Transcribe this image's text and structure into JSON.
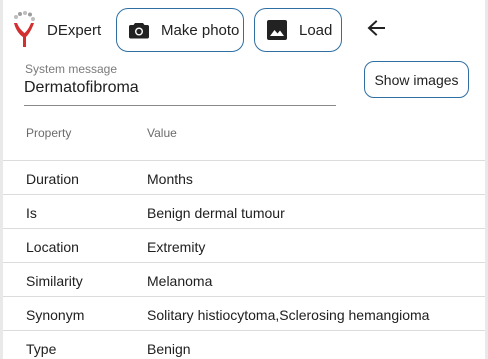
{
  "app": {
    "title": "DExpert"
  },
  "toolbar": {
    "photo_label": "Make photo",
    "load_label": "Load"
  },
  "system_message": {
    "label": "System message",
    "value": "Dermatofibroma"
  },
  "show_images_label": "Show images",
  "table": {
    "headers": [
      "Property",
      "Value"
    ],
    "rows": [
      [
        "Duration",
        "Months"
      ],
      [
        "Is",
        "Benign dermal tumour"
      ],
      [
        "Location",
        "Extremity"
      ],
      [
        "Similarity",
        "Melanoma"
      ],
      [
        "Synonym",
        "Solitary histiocytoma,Sclerosing hemangioma"
      ],
      [
        "Type",
        "Benign"
      ]
    ]
  },
  "colors": {
    "accent": "#2f6fa3",
    "logo_red": "#d32f2f",
    "logo_gray": "#9e9e9e"
  },
  "icons": {
    "photo": "camera-icon",
    "load": "image-icon",
    "back": "arrow-left-icon",
    "logo": "dexpert-logo"
  }
}
